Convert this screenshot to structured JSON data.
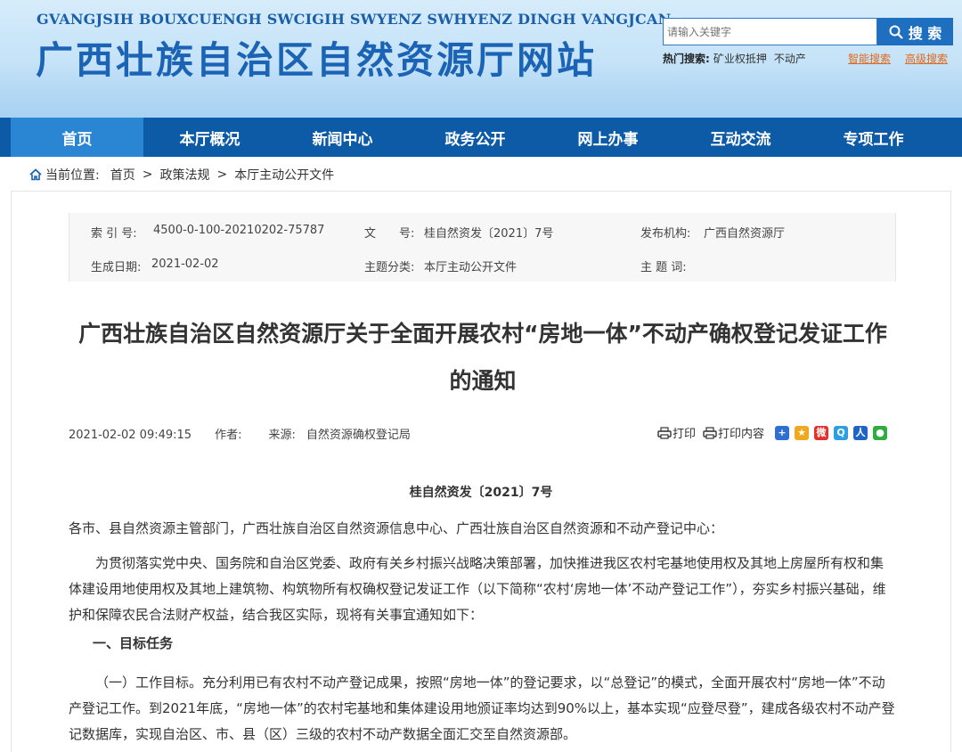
{
  "header": {
    "subtitle": "GVANGJSIH BOUXCUENGH SWCIGIH SWYENZ SWHYENZ DINGH VANGJCAN",
    "title": "广西壮族自治区自然资源厅网站",
    "search_placeholder": "请输入关键字",
    "search_button": "搜 索",
    "hot_label": "热门搜索:",
    "hot_keywords": [
      "矿业权抵押",
      "不动产"
    ],
    "smart_search": "智能搜索",
    "advanced_search": "高级搜索"
  },
  "nav": {
    "items": [
      {
        "label": "首页"
      },
      {
        "label": "本厅概况"
      },
      {
        "label": "新闻中心"
      },
      {
        "label": "政务公开"
      },
      {
        "label": "网上办事"
      },
      {
        "label": "互动交流"
      },
      {
        "label": "专项工作"
      }
    ]
  },
  "breadcrumb": {
    "prefix": "当前位置:",
    "items": [
      "首页",
      "政策法规",
      "本厅主动公开文件"
    ],
    "separator": ">"
  },
  "meta": {
    "index_label": "索 引 号:",
    "index_value": "4500-0-100-20210202-75787",
    "docnum_label": "文　　号:",
    "docnum_value": "桂自然资发〔2021〕7号",
    "publisher_label": "发布机构:",
    "publisher_value": "广西自然资源厅",
    "date_label": "生成日期:",
    "date_value": "2021-02-02",
    "category_label": "主题分类:",
    "category_value": "本厅主动公开文件",
    "subject_label": "主 题 词:",
    "subject_value": ""
  },
  "article": {
    "title": "广西壮族自治区自然资源厅关于全面开展农村“房地一体”不动产确权登记发证工作的通知",
    "datetime": "2021-02-02 09:49:15",
    "author_label": "作者:",
    "source_label": "来源:",
    "source_value": "自然资源确权登记局",
    "print_label": "打印",
    "print_content_label": "打印内容",
    "doc_number": "桂自然资发〔2021〕7号",
    "addressee": "各市、县自然资源主管部门，广西壮族自治区自然资源信息中心、广西壮族自治区自然资源和不动产登记中心：",
    "para1": "为贯彻落实党中央、国务院和自治区党委、政府有关乡村振兴战略决策部署，加快推进我区农村宅基地使用权及其地上房屋所有权和集体建设用地使用权及其地上建筑物、构筑物所有权确权登记发证工作（以下简称“农村‘房地一体’不动产登记工作”），夯实乡村振兴基础，维护和保障农民合法财产权益，结合我区实际，现将有关事宜通知如下：",
    "section1": "一、目标任务",
    "para2": "（一）工作目标。充分利用已有农村不动产登记成果，按照“房地一体”的登记要求，以“总登记”的模式，全面开展农村“房地一体”不动产登记工作。到2021年底，“房地一体”的农村宅基地和集体建设用地颁证率均达到90%以上，基本实现“应登尽登”，建成各级农村不动产登记数据库，实现自治区、市、县（区）三级的农村不动产数据全面汇交至自然资源部。"
  },
  "colors": {
    "nav_bg": "#0d5aa7",
    "nav_active": "#2a86d3",
    "title_blue": "#1b63b5",
    "link_orange": "#e06a1a"
  },
  "share_icons": [
    "qzone-icon",
    "favorite-icon",
    "weibo-icon",
    "qq-icon",
    "renren-icon",
    "wechat-icon"
  ]
}
